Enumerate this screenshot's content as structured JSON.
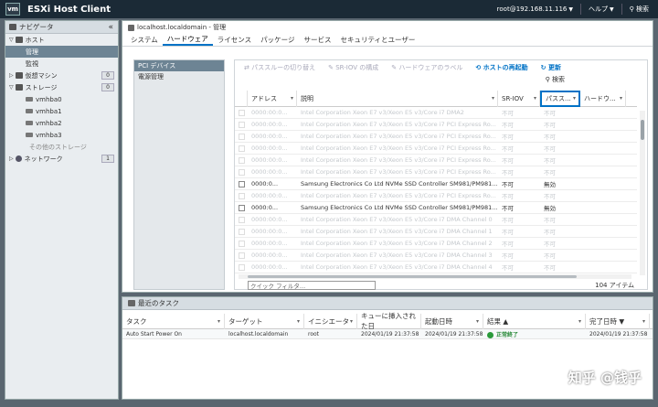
{
  "app": {
    "logo": "vm",
    "title": "ESXi Host Client"
  },
  "topbar": {
    "user": "root@192.168.11.116",
    "help": "ヘルプ",
    "search": "検索"
  },
  "nav": {
    "header": "ナビゲータ",
    "host": "ホスト",
    "manage": "管理",
    "monitor": "監視",
    "vms": {
      "label": "仮想マシン",
      "count": "0"
    },
    "storage": {
      "label": "ストレージ",
      "count": "0"
    },
    "adapters": [
      "vmhba0",
      "vmhba1",
      "vmhba2",
      "vmhba3"
    ],
    "other_storage": "その他のストレージ",
    "network": {
      "label": "ネットワーク",
      "count": "1"
    }
  },
  "main": {
    "title": "localhost.localdomain - 管理",
    "tabs": [
      "システム",
      "ハードウェア",
      "ライセンス",
      "パッケージ",
      "サービス",
      "セキュリティとユーザー"
    ],
    "active_tab": "ハードウェア"
  },
  "pci_panel": {
    "items": [
      "PCI デバイス",
      "電源管理"
    ]
  },
  "toolbar": {
    "toggle_passthrough": "パススルーの切り替え",
    "sriov": "SR-IOV の構成",
    "hw_label": "ハードウェアのラベル",
    "reboot": "ホストの再起動",
    "refresh": "更新",
    "search": "検索"
  },
  "grid": {
    "columns": [
      "アドレス",
      "説明",
      "SR-IOV",
      "パスス...",
      "ハードウ..."
    ],
    "rows": [
      {
        "addr": "0000:00:0...",
        "desc": "Intel Corporation Xeon E7 v3/Xeon E5 v3/Core i7 DMA2",
        "sriov": "不可",
        "pass": "不可",
        "dim": true,
        "check": false
      },
      {
        "addr": "0000:00:0...",
        "desc": "Intel Corporation Xeon E7 v3/Xeon E5 v3/Core i7 PCI Express Ro...",
        "sriov": "不可",
        "pass": "不可",
        "dim": true,
        "check": false
      },
      {
        "addr": "0000:00:0...",
        "desc": "Intel Corporation Xeon E7 v3/Xeon E5 v3/Core i7 PCI Express Ro...",
        "sriov": "不可",
        "pass": "不可",
        "dim": true,
        "check": false
      },
      {
        "addr": "0000:00:0...",
        "desc": "Intel Corporation Xeon E7 v3/Xeon E5 v3/Core i7 PCI Express Ro...",
        "sriov": "不可",
        "pass": "不可",
        "dim": true,
        "check": false
      },
      {
        "addr": "0000:00:0...",
        "desc": "Intel Corporation Xeon E7 v3/Xeon E5 v3/Core i7 PCI Express Ro...",
        "sriov": "不可",
        "pass": "不可",
        "dim": true,
        "check": false
      },
      {
        "addr": "0000:00:0...",
        "desc": "Intel Corporation Xeon E7 v3/Xeon E5 v3/Core i7 PCI Express Ro...",
        "sriov": "不可",
        "pass": "不可",
        "dim": true,
        "check": false
      },
      {
        "addr": "0000:0...",
        "desc": "Samsung Electronics Co Ltd NVMe SSD Controller SM981/PM981...",
        "sriov": "不可",
        "pass": "無効",
        "dim": false,
        "check": true
      },
      {
        "addr": "0000:00:0...",
        "desc": "Intel Corporation Xeon E7 v3/Xeon E5 v3/Core i7 PCI Express Ro...",
        "sriov": "不可",
        "pass": "不可",
        "dim": true,
        "check": false
      },
      {
        "addr": "0000:0...",
        "desc": "Samsung Electronics Co Ltd NVMe SSD Controller SM981/PM981...",
        "sriov": "不可",
        "pass": "無効",
        "dim": false,
        "check": true
      },
      {
        "addr": "0000:00:0...",
        "desc": "Intel Corporation Xeon E7 v3/Xeon E5 v3/Core i7 DMA Channel 0",
        "sriov": "不可",
        "pass": "不可",
        "dim": true,
        "check": false
      },
      {
        "addr": "0000:00:0...",
        "desc": "Intel Corporation Xeon E7 v3/Xeon E5 v3/Core i7 DMA Channel 1",
        "sriov": "不可",
        "pass": "不可",
        "dim": true,
        "check": false
      },
      {
        "addr": "0000:00:0...",
        "desc": "Intel Corporation Xeon E7 v3/Xeon E5 v3/Core i7 DMA Channel 2",
        "sriov": "不可",
        "pass": "不可",
        "dim": true,
        "check": false
      },
      {
        "addr": "0000:00:0...",
        "desc": "Intel Corporation Xeon E7 v3/Xeon E5 v3/Core i7 DMA Channel 3",
        "sriov": "不可",
        "pass": "不可",
        "dim": true,
        "check": false
      },
      {
        "addr": "0000:00:0...",
        "desc": "Intel Corporation Xeon E7 v3/Xeon E5 v3/Core i7 DMA Channel 4",
        "sriov": "不可",
        "pass": "不可",
        "dim": true,
        "check": false
      }
    ],
    "quick_filter": "クイック フィルタ...",
    "count": "104 アイテム"
  },
  "tasks": {
    "header": "最近のタスク",
    "columns": [
      "タスク",
      "ターゲット",
      "イニシエータ",
      "キューに挿入された日",
      "起動日時",
      "結果 ▲",
      "完了日時 ▼"
    ],
    "rows": [
      {
        "task": "Auto Start Power On",
        "target": "localhost.localdomain",
        "initiator": "root",
        "queued": "2024/01/19 21:37:58",
        "started": "2024/01/19 21:37:58",
        "result": "正常終了",
        "completed": "2024/01/19 21:37:58"
      }
    ]
  },
  "watermark": "知乎 @钱乎"
}
